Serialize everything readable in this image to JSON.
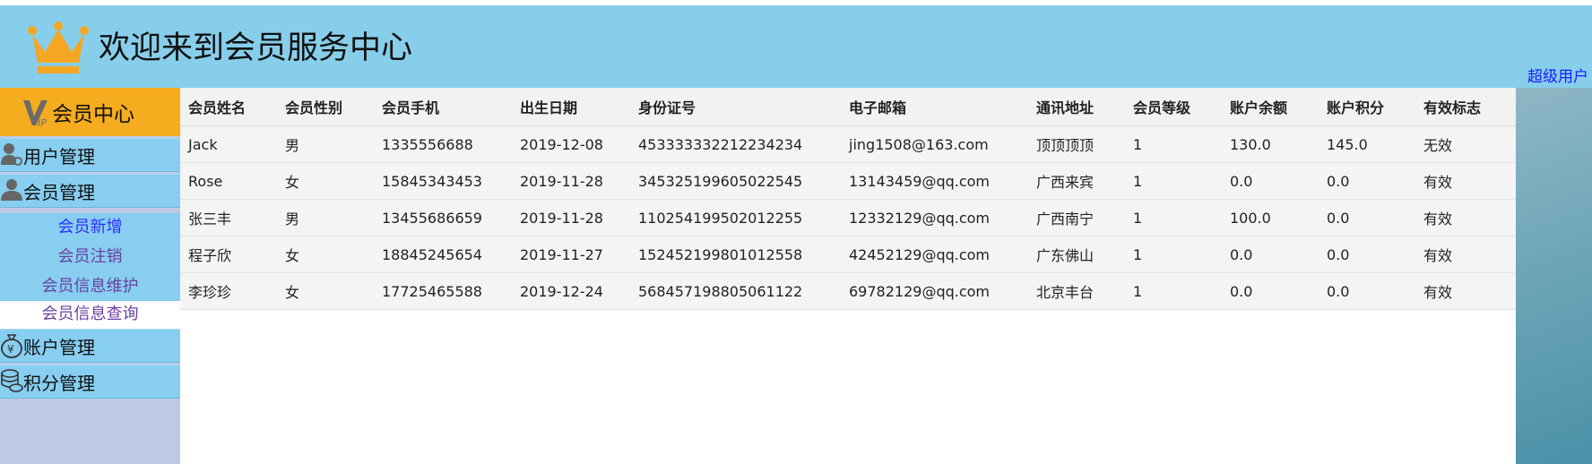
{
  "header": {
    "title": "欢迎来到会员服务中心",
    "super_user_link": "超级用户",
    "bg_color": "#87ceeb",
    "crown_icon": "crown-icon",
    "crown_color": "#f5a623"
  },
  "sidebar": {
    "head_label": "会员中心",
    "head_icon": "vip-icon",
    "head_color": "#f5ac1f",
    "items": [
      {
        "label": "用户管理",
        "icon": "user-gear-icon"
      },
      {
        "label": "会员管理",
        "icon": "user-icon"
      },
      {
        "label": "账户管理",
        "icon": "money-bag-icon"
      },
      {
        "label": "积分管理",
        "icon": "coins-icon"
      }
    ],
    "sub_items": [
      "会员新增",
      "会员注销",
      "会员信息维护",
      "会员信息查询"
    ]
  },
  "table": {
    "columns": [
      "会员姓名",
      "会员性别",
      "会员手机",
      "出生日期",
      "身份证号",
      "电子邮箱",
      "通讯地址",
      "会员等级",
      "账户余额",
      "账户积分",
      "有效标志"
    ],
    "rows": [
      [
        "Jack",
        "男",
        "1335556688",
        "2019-12-08",
        "453333332212234234",
        "jing1508@163.com",
        "顶顶顶顶",
        "1",
        "130.0",
        "145.0",
        "无效"
      ],
      [
        "Rose",
        "女",
        "15845343453",
        "2019-11-28",
        "345325199605022545",
        "13143459@qq.com",
        "广西来宾",
        "1",
        "0.0",
        "0.0",
        "有效"
      ],
      [
        "张三丰",
        "男",
        "13455686659",
        "2019-11-28",
        "110254199502012255",
        "12332129@qq.com",
        "广西南宁",
        "1",
        "100.0",
        "0.0",
        "有效"
      ],
      [
        "程子欣",
        "女",
        "18845245654",
        "2019-11-27",
        "152452199801012558",
        "42452129@qq.com",
        "广东佛山",
        "1",
        "0.0",
        "0.0",
        "有效"
      ],
      [
        "李珍珍",
        "女",
        "17725465588",
        "2019-12-24",
        "568457198805061122",
        "69782129@qq.com",
        "北京丰台",
        "1",
        "0.0",
        "0.0",
        "有效"
      ]
    ]
  }
}
